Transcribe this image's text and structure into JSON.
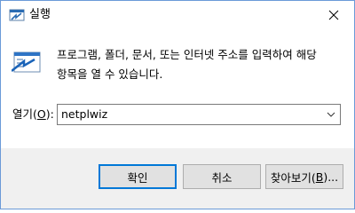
{
  "window": {
    "title": "실행"
  },
  "dialog": {
    "description": "프로그램, 폴더, 문서, 또는 인터넷 주소를 입력하여 해당\n항목을 열 수 있습니다.",
    "open_label": "열기(",
    "open_mnemonic": "O",
    "open_label_end": "):",
    "input_value": "netplwiz"
  },
  "buttons": {
    "ok": "확인",
    "cancel": "취소",
    "browse_prefix": "찾아보기(",
    "browse_mnemonic": "B",
    "browse_suffix": ")..."
  },
  "colors": {
    "accent": "#0078d7",
    "footer": "#f0f0f0",
    "button_face": "#e1e1e1"
  }
}
